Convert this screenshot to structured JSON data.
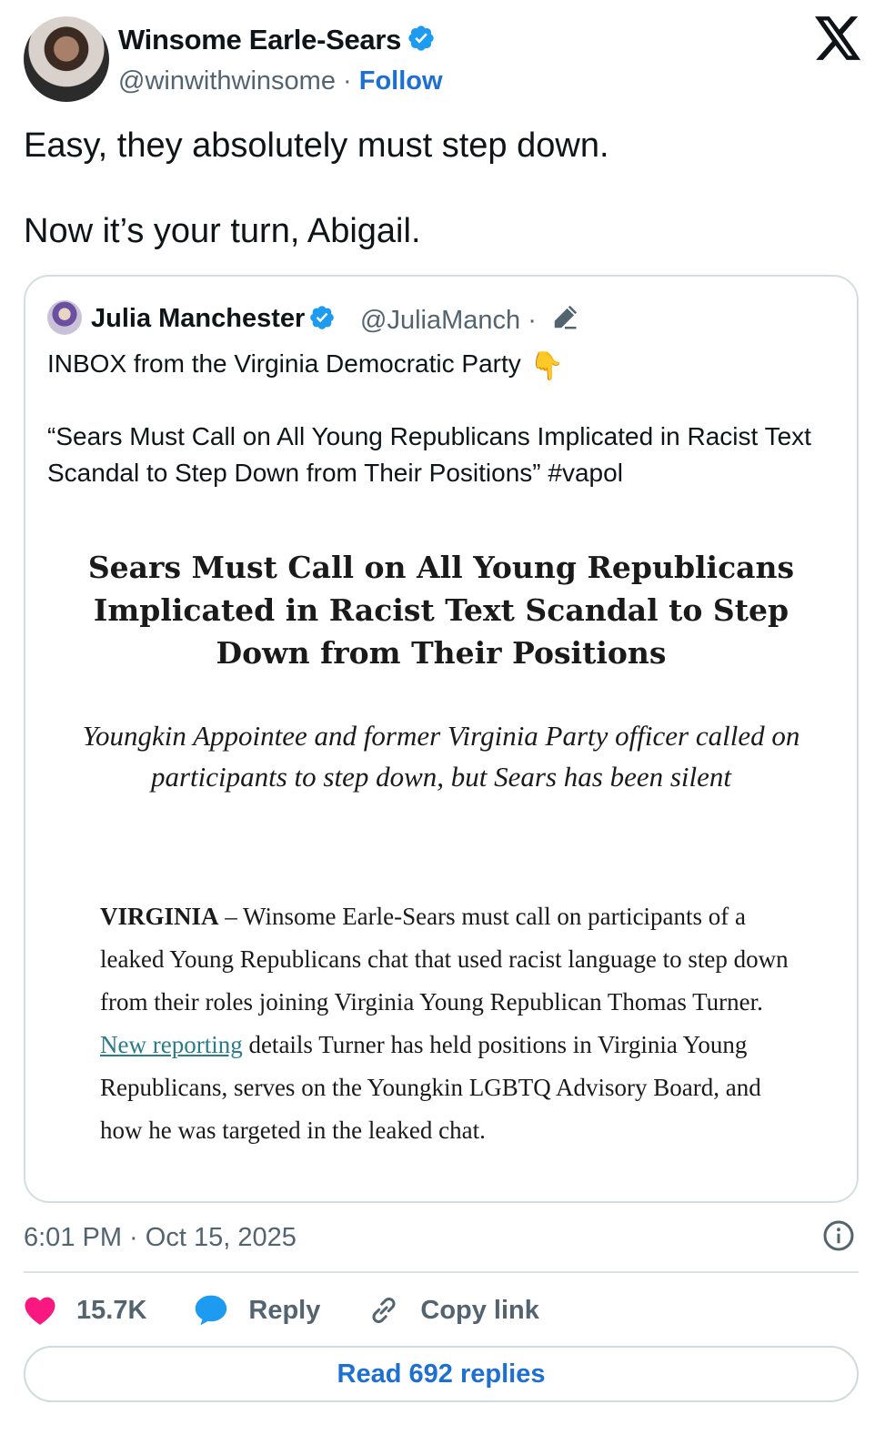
{
  "tweet": {
    "author_name": "Winsome Earle-Sears",
    "author_handle": "@winwithwinsome",
    "separator": "·",
    "follow_label": "Follow",
    "text_line1": "Easy, they absolutely must step down.",
    "text_line2": "Now it’s your turn, Abigail.",
    "timestamp": "6:01 PM · Oct 15, 2025",
    "likes": "15.7K",
    "reply_label": "Reply",
    "copy_link_label": "Copy link",
    "read_replies_label": "Read 692 replies"
  },
  "quote": {
    "author_name": "Julia Manchester",
    "author_handle": "@JuliaManch",
    "separator": "·",
    "line1": "INBOX from the Virginia Democratic Party",
    "hand_emoji": "👇",
    "line2": "“Sears Must Call on All Young Republicans Implicated in Racist Text Scandal to Step Down from Their Positions” #vapol",
    "doc_title": "Sears Must Call on All Young Republicans Implicated in Racist Text Scandal to Step Down from Their Positions",
    "doc_subtitle": "Youngkin Appointee and former Virginia Party officer called on participants to step down, but Sears has been silent",
    "doc_lead": "VIRGINIA",
    "doc_body_1": " – Winsome Earle-Sears must call on participants of a leaked Young Republicans chat that used racist language to step down from their roles joining Virginia Young Republican Thomas Turner. ",
    "doc_link": "New reporting",
    "doc_body_2": " details Turner has held positions in Virginia Young Republicans, serves on the Youngkin LGBTQ Advisory Board, and how he was targeted in the leaked chat."
  },
  "colors": {
    "accent_blue": "#1d6fd1",
    "verified_blue": "#1d9bf0",
    "like_pink": "#f91880",
    "muted_gray": "#536471"
  },
  "icons": [
    "verified-badge-icon",
    "x-logo-icon",
    "edit-pencil-icon",
    "pointing-down-emoji",
    "info-icon",
    "heart-icon",
    "reply-bubble-icon",
    "link-icon"
  ]
}
